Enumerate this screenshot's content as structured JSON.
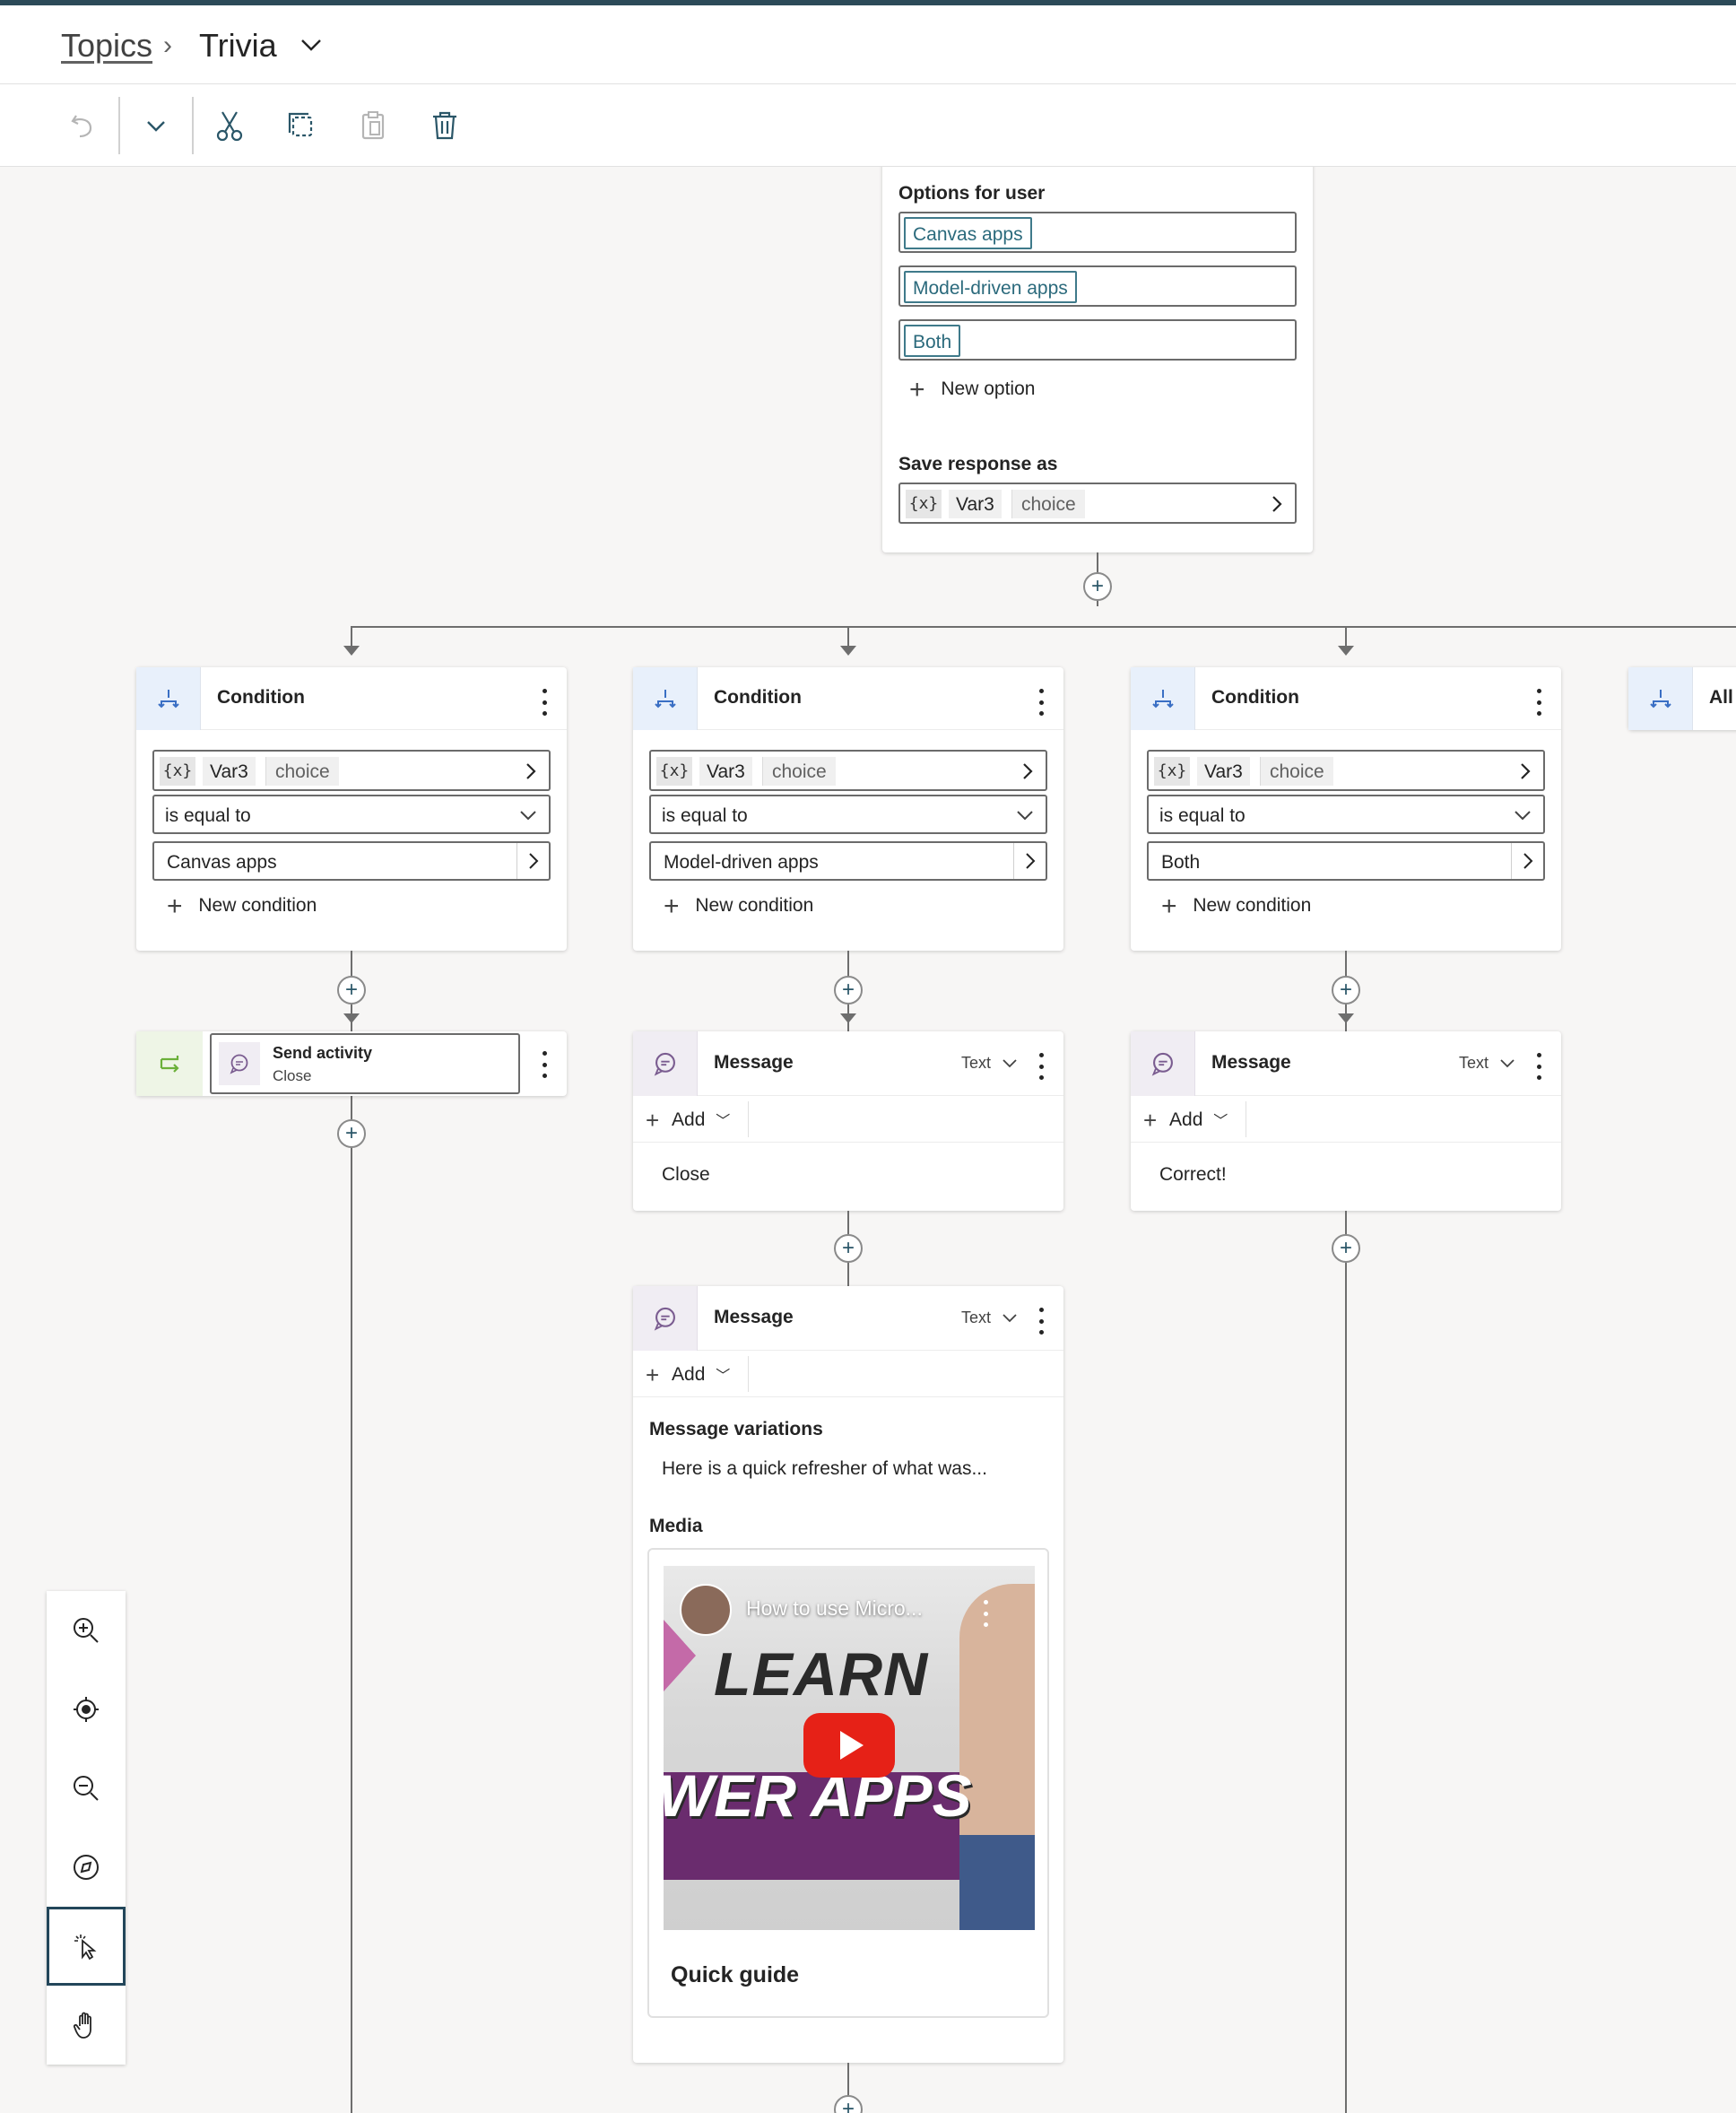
{
  "breadcrumb": {
    "root": "Topics",
    "current": "Trivia"
  },
  "question_card": {
    "options_label": "Options for user",
    "options": [
      "Canvas apps",
      "Model-driven apps",
      "Both"
    ],
    "new_option": "New option",
    "save_label": "Save response as",
    "var_icon": "{x}",
    "var_name": "Var3",
    "var_type": "choice"
  },
  "conditions": [
    {
      "title": "Condition",
      "var_icon": "{x}",
      "var_name": "Var3",
      "var_type": "choice",
      "operator": "is equal to",
      "value": "Canvas apps",
      "new_condition": "New condition"
    },
    {
      "title": "Condition",
      "var_icon": "{x}",
      "var_name": "Var3",
      "var_type": "choice",
      "operator": "is equal to",
      "value": "Model-driven apps",
      "new_condition": "New condition"
    },
    {
      "title": "Condition",
      "var_icon": "{x}",
      "var_name": "Var3",
      "var_type": "choice",
      "operator": "is equal to",
      "value": "Both",
      "new_condition": "New condition"
    }
  ],
  "all_other": {
    "title": "All"
  },
  "send_activity": {
    "title": "Send activity",
    "subtitle": "Close"
  },
  "messages": [
    {
      "title": "Message",
      "type": "Text",
      "add": "Add",
      "text": "Close"
    },
    {
      "title": "Message",
      "type": "Text",
      "add": "Add",
      "text": "Correct!"
    }
  ],
  "message_media": {
    "title": "Message",
    "type": "Text",
    "add": "Add",
    "variations_label": "Message variations",
    "variation_text": "Here is a quick refresher of what was...",
    "media_label": "Media",
    "video_title": "How to use Micro...",
    "thumb_text_1": "LEARN",
    "thumb_text_2": "WER APPS",
    "caption": "Quick guide"
  },
  "zoom_controls": [
    "zoom-in",
    "recenter",
    "zoom-out",
    "minimap",
    "select",
    "pan"
  ],
  "colors": {
    "accent": "#2c4a58",
    "condition_bg": "#e8f0fb",
    "message_bg": "#f0edf3",
    "tag": "#2b6a7c"
  }
}
